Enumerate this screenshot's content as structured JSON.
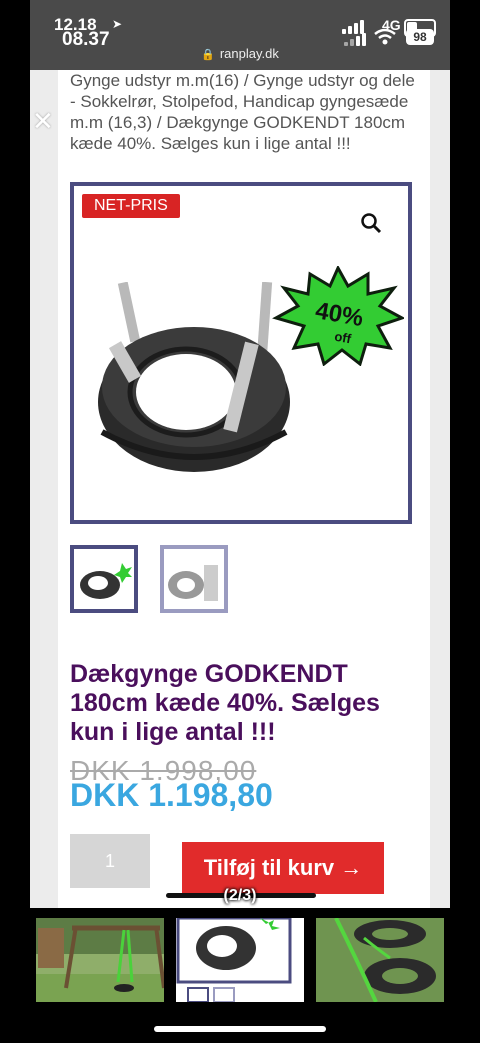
{
  "status_bar": {
    "time_top": "12.18",
    "time_bottom": "08.37",
    "network": "4G",
    "battery": "98",
    "url": "ranplay.dk"
  },
  "icons": {
    "location": "location-arrow-icon",
    "lock": "lock-icon",
    "close": "close-icon",
    "zoom": "magnifier-icon",
    "arrow": "arrow-right-icon"
  },
  "breadcrumb": "Gynge udstyr m.m(16) / Gynge udstyr og dele - Sokkelrør, Stolpefod, Handicap gyngesæde m.m (16,3) / Dækgynge GODKENDT 180cm kæde 40%. Sælges kun i lige antal !!!",
  "product": {
    "badge": "NET-PRIS",
    "discount_line1": "40%",
    "discount_line2": "off",
    "title": "Dækgynge GODKENDT 180cm kæde 40%. Sælges kun i lige antal !!!",
    "old_price": "DKK 1.998,00",
    "new_price": "DKK 1.198,80",
    "quantity": "1",
    "add_to_cart": "Tilføj til kurv →"
  },
  "gallery": {
    "counter": "(2/3)"
  },
  "colors": {
    "title": "#4a0f5c",
    "price": "#3aa7e0",
    "badge": "#d82424",
    "button": "#e12b2b",
    "frame_border": "#4b4c80"
  }
}
